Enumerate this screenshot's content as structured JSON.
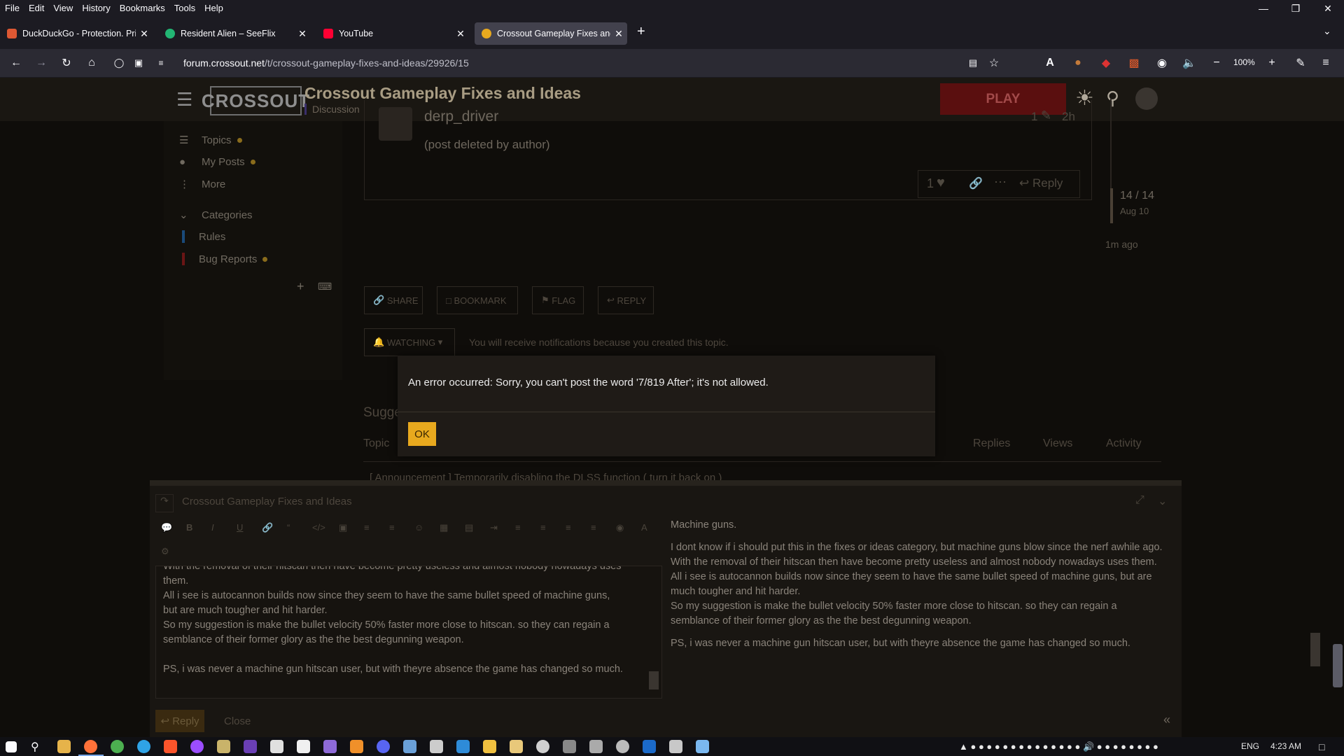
{
  "menu": [
    "File",
    "Edit",
    "View",
    "History",
    "Bookmarks",
    "Tools",
    "Help"
  ],
  "tabs": [
    {
      "title": "DuckDuckGo - Protection. Priva",
      "color": "#de5833"
    },
    {
      "title": "Resident Alien – SeeFlix",
      "color": "#22b573"
    },
    {
      "title": "YouTube",
      "color": "#ff0033"
    },
    {
      "title": "Crossout Gameplay Fixes and Ide",
      "color": "#e8a91e"
    }
  ],
  "url": {
    "domain": "forum.crossout.net",
    "path": "/t/crossout-gameplay-fixes-and-ideas/29926/15"
  },
  "zoom": "100%",
  "site": {
    "logo": "CROSSOUT",
    "title": "Crossout Gameplay Fixes and Ideas",
    "category": "Discussion",
    "play": "PLAY"
  },
  "sidebar": {
    "topics": "Topics",
    "my_posts": "My Posts",
    "more": "More",
    "categories": "Categories",
    "rules": "Rules",
    "bug_reports": "Bug Reports"
  },
  "post": {
    "author": "derp_driver",
    "body": "(post deleted by author)",
    "edits": "1",
    "age": "2h",
    "likes": "1",
    "reply": "Reply"
  },
  "timeline": {
    "position": "14 / 14",
    "date": "Aug 10",
    "ago": "1m ago"
  },
  "actions": {
    "share": "SHARE",
    "bookmark": "BOOKMARK",
    "flag": "FLAG",
    "reply": "REPLY",
    "watching": "WATCHING",
    "notice": "You will receive notifications because you created this topic."
  },
  "suggested": {
    "heading": "Sugge",
    "topic": "Topic",
    "replies": "Replies",
    "views": "Views",
    "activity": "Activity",
    "row": "[ Announcement ] Temporarily disabling the DLSS function ( turn it back on )"
  },
  "modal": {
    "message": "An error occurred: Sorry, you can't post the word '7/819 After'; it's not allowed.",
    "ok": "OK"
  },
  "composer": {
    "title": "Crossout Gameplay Fixes and Ideas",
    "reply": "Reply",
    "close": "Close",
    "editor_lines": [
      "With the removal of their hitscan then have become pretty useless and almost nobody nowadays uses",
      "them.",
      "All i see is autocannon builds now since they seem to have the same bullet speed of machine guns,",
      "but are much tougher and hit harder.",
      "So my suggestion is make the bullet velocity 50% faster more close to hitscan. so they can regain a",
      "semblance of their former glory as the the best degunning weapon.",
      "",
      "PS, i was never a machine gun hitscan user, but with theyre absence the game has changed so much."
    ],
    "preview": [
      "Machine guns.",
      "I dont know if i should put this in the fixes or ideas category, but machine guns blow since the nerf awhile ago.\nWith the removal of their hitscan then have become pretty useless and almost nobody nowadays uses them.\nAll i see is autocannon builds now since they seem to have the same bullet speed of machine guns, but are much tougher and hit harder.\nSo my suggestion is make the bullet velocity 50% faster more close to hitscan. so they can regain a semblance of their former glory as the the best degunning weapon.",
      "PS, i was never a machine gun hitscan user, but with theyre absence the game has changed so much."
    ]
  },
  "taskbar": {
    "lang": "ENG",
    "time": "4:23 AM"
  }
}
